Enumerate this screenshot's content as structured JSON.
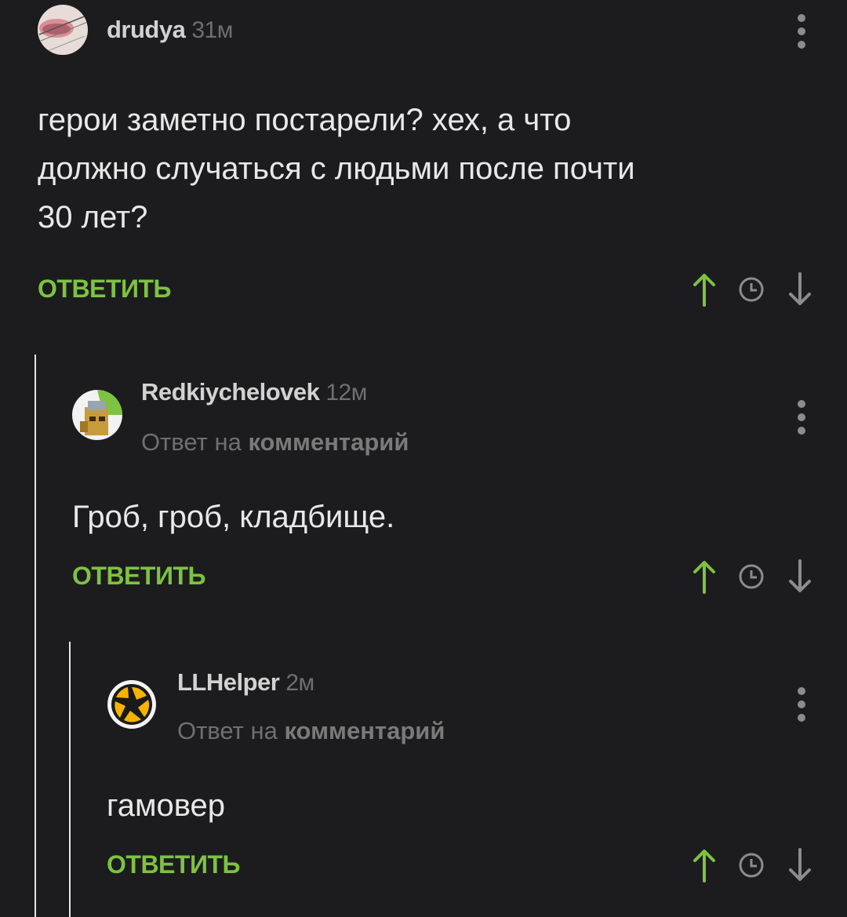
{
  "comments": [
    {
      "author": "drudya",
      "time": "31м",
      "reply_prefix": "",
      "reply_target": "",
      "lines": [
        "герои заметно постарели? хех, а что",
        "должно случаться с людьми после почти",
        "30 лет?"
      ],
      "reply_label": "ОТВЕТИТЬ"
    },
    {
      "author": "Redkiychelovek",
      "time": "12м",
      "reply_prefix": "Ответ на",
      "reply_target": "комментарий",
      "lines": [
        "Гроб, гроб, кладбище."
      ],
      "reply_label": "ОТВЕТИТЬ"
    },
    {
      "author": "LLHelper",
      "time": "2м",
      "reply_prefix": "Ответ на",
      "reply_target": "комментарий",
      "lines": [
        "гамовер"
      ],
      "reply_label": "ОТВЕТИТЬ"
    }
  ],
  "icons": {
    "upvote": "arrow-up-icon",
    "time_sort": "clock-icon",
    "downvote": "arrow-down-icon",
    "more": "more-vertical-icon"
  },
  "colors": {
    "background": "#1c1c1e",
    "accent_green": "#7dc242",
    "muted": "#6f6f6f",
    "text": "#e8e8e8"
  }
}
